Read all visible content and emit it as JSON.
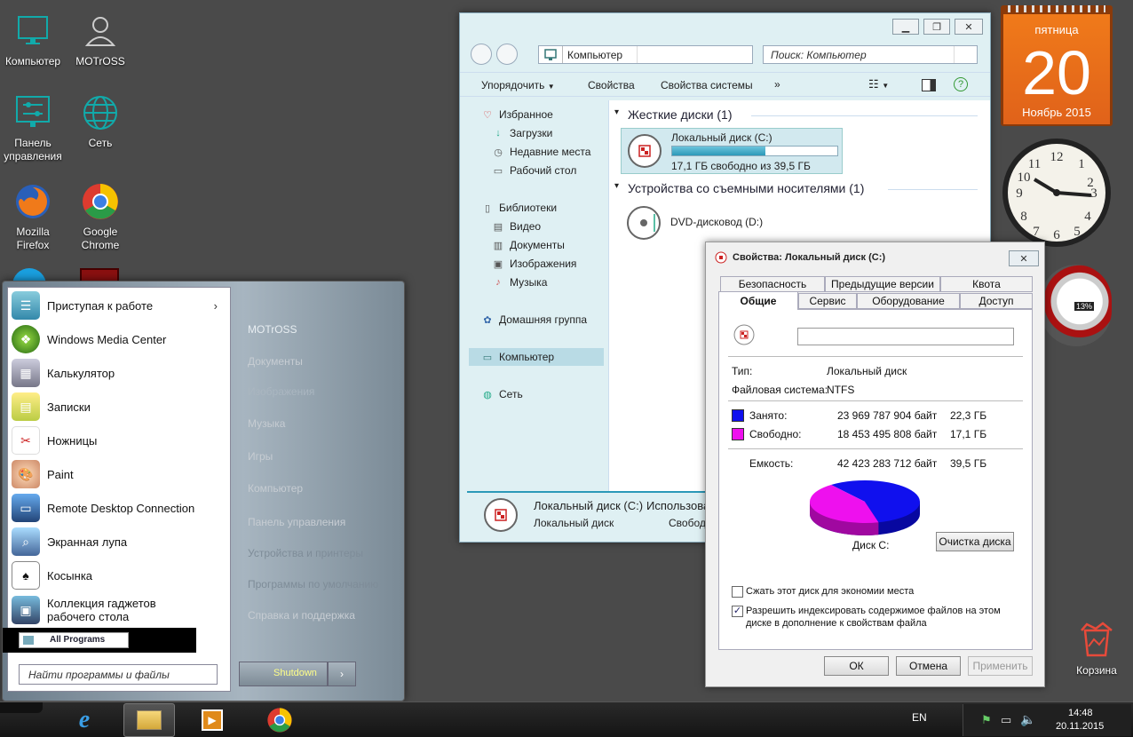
{
  "desktop": {
    "icons": [
      {
        "label": "Компьютер",
        "icon": "monitor-icon"
      },
      {
        "label": "MOTrOSS",
        "icon": "user-icon"
      },
      {
        "label": "Панель управления",
        "icon": "control-panel-icon"
      },
      {
        "label": "Сеть",
        "icon": "globe-icon"
      },
      {
        "label": "Mozilla Firefox",
        "icon": "firefox-icon"
      },
      {
        "label": "Google Chrome",
        "icon": "chrome-icon"
      }
    ],
    "recycle_bin": "Корзина"
  },
  "calendar": {
    "weekday": "пятница",
    "day": "20",
    "month_year": "Ноябрь 2015"
  },
  "cpu_gadget": {
    "value": "13%"
  },
  "explorer": {
    "address": "Компьютер",
    "search_placeholder": "Поиск: Компьютер",
    "toolbar": {
      "organize": "Упорядочить",
      "properties": "Свойства",
      "system_properties": "Свойства системы",
      "more": "»"
    },
    "nav": {
      "favorites": "Избранное",
      "downloads": "Загрузки",
      "recent": "Недавние места",
      "desktop": "Рабочий стол",
      "libraries": "Библиотеки",
      "video": "Видео",
      "documents": "Документы",
      "images": "Изображения",
      "music": "Музыка",
      "homegroup": "Домашняя группа",
      "computer": "Компьютер",
      "network": "Сеть"
    },
    "hard_disks_header": "Жесткие диски (1)",
    "local_disk": {
      "name": "Локальный диск (C:)",
      "free": "17,1 ГБ свободно из 39,5 ГБ",
      "used_fraction": 0.567
    },
    "removable_header": "Устройства со съемными носителями (1)",
    "dvd": {
      "name": "DVD-дисковод (D:)"
    },
    "details": {
      "name": "Локальный диск (C:)",
      "used_label": "Использова",
      "type": "Локальный диск",
      "free_label": "Свобод"
    }
  },
  "dialog": {
    "title": "Свойства: Локальный диск (C:)",
    "tabs_row1": [
      "Безопасность",
      "Предыдущие версии",
      "Квота"
    ],
    "tabs_row2": [
      "Общие",
      "Сервис",
      "Оборудование",
      "Доступ"
    ],
    "name_value": "",
    "type_label": "Тип:",
    "type_value": "Локальный диск",
    "fs_label": "Файловая система:",
    "fs_value": "NTFS",
    "used_label": "Занято:",
    "used_bytes": "23 969 787 904 байт",
    "used_gb": "22,3 ГБ",
    "free_label": "Свободно:",
    "free_bytes": "18 453 495 808 байт",
    "free_gb": "17,1 ГБ",
    "capacity_label": "Емкость:",
    "capacity_bytes": "42 423 283 712 байт",
    "capacity_gb": "39,5 ГБ",
    "disk_label": "Диск C:",
    "cleanup_button": "Очистка диска",
    "compress_label": "Сжать этот диск для экономии места",
    "index_label_1": "Разрешить индексировать содержимое файлов на этом",
    "index_label_2": "диске в дополнение к свойствам файла",
    "ok": "ОК",
    "cancel": "Отмена",
    "apply": "Применить",
    "colors": {
      "used": "#1010ee",
      "free": "#ee10ee"
    },
    "chart_data": {
      "type": "pie",
      "categories": [
        "Занято",
        "Свободно"
      ],
      "values": [
        23969787904,
        18453495808
      ],
      "title": "Диск C:"
    }
  },
  "start_menu": {
    "programs": [
      {
        "label": "Приступая к работе",
        "arrow": "›"
      },
      {
        "label": "Windows Media Center"
      },
      {
        "label": "Калькулятор"
      },
      {
        "label": "Записки"
      },
      {
        "label": "Ножницы"
      },
      {
        "label": "Paint"
      },
      {
        "label": "Remote Desktop Connection"
      },
      {
        "label": "Экранная лупа"
      },
      {
        "label": "Косынка"
      },
      {
        "label": "Коллекция гаджетов рабочего стола"
      }
    ],
    "all_programs": "All Programs",
    "search_placeholder": "Найти программы и файлы",
    "right": [
      "MOTrOSS",
      "Документы",
      "Изображения",
      "Музыка",
      "Игры",
      "Компьютер",
      "Панель управления",
      "Устройства и принтеры",
      "Программы по умолчанию",
      "Справка и поддержка"
    ],
    "shutdown": "Shutdown",
    "shutdown_arrow": "›"
  },
  "taskbar": {
    "lang": "EN",
    "time": "14:48",
    "date": "20.11.2015"
  }
}
